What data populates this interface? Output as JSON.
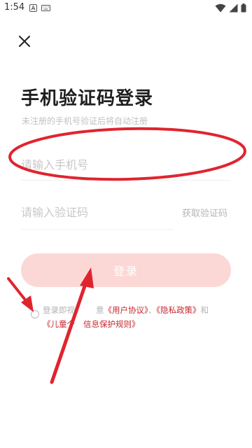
{
  "status_bar": {
    "time": "1:54",
    "left_icons": [
      "a-badge-icon",
      "keyboard-icon"
    ],
    "right_icons": [
      "wifi-icon",
      "signal-icon",
      "battery-icon"
    ]
  },
  "header": {
    "close_icon": "close-icon"
  },
  "login": {
    "title": "手机验证码登录",
    "subtitle": "未注册的手机号验证后将自动注册",
    "phone_placeholder": "请输入手机号",
    "code_placeholder": "请输入验证码",
    "get_code_label": "获取验证码",
    "submit_label": "登录",
    "agreement": {
      "prefix": "登录即视",
      "middle": "意",
      "user_agreement": "《用户协议》",
      "separator": "、",
      "privacy_policy": "《隐私政策》",
      "and": "和",
      "personal_info_open": "《儿童个",
      "personal_info_close": "信息保护规则》"
    }
  },
  "colors": {
    "accent_red": "#c7262f",
    "button_disabled": "#fbd8d6",
    "annotation_red": "#e0242f"
  }
}
